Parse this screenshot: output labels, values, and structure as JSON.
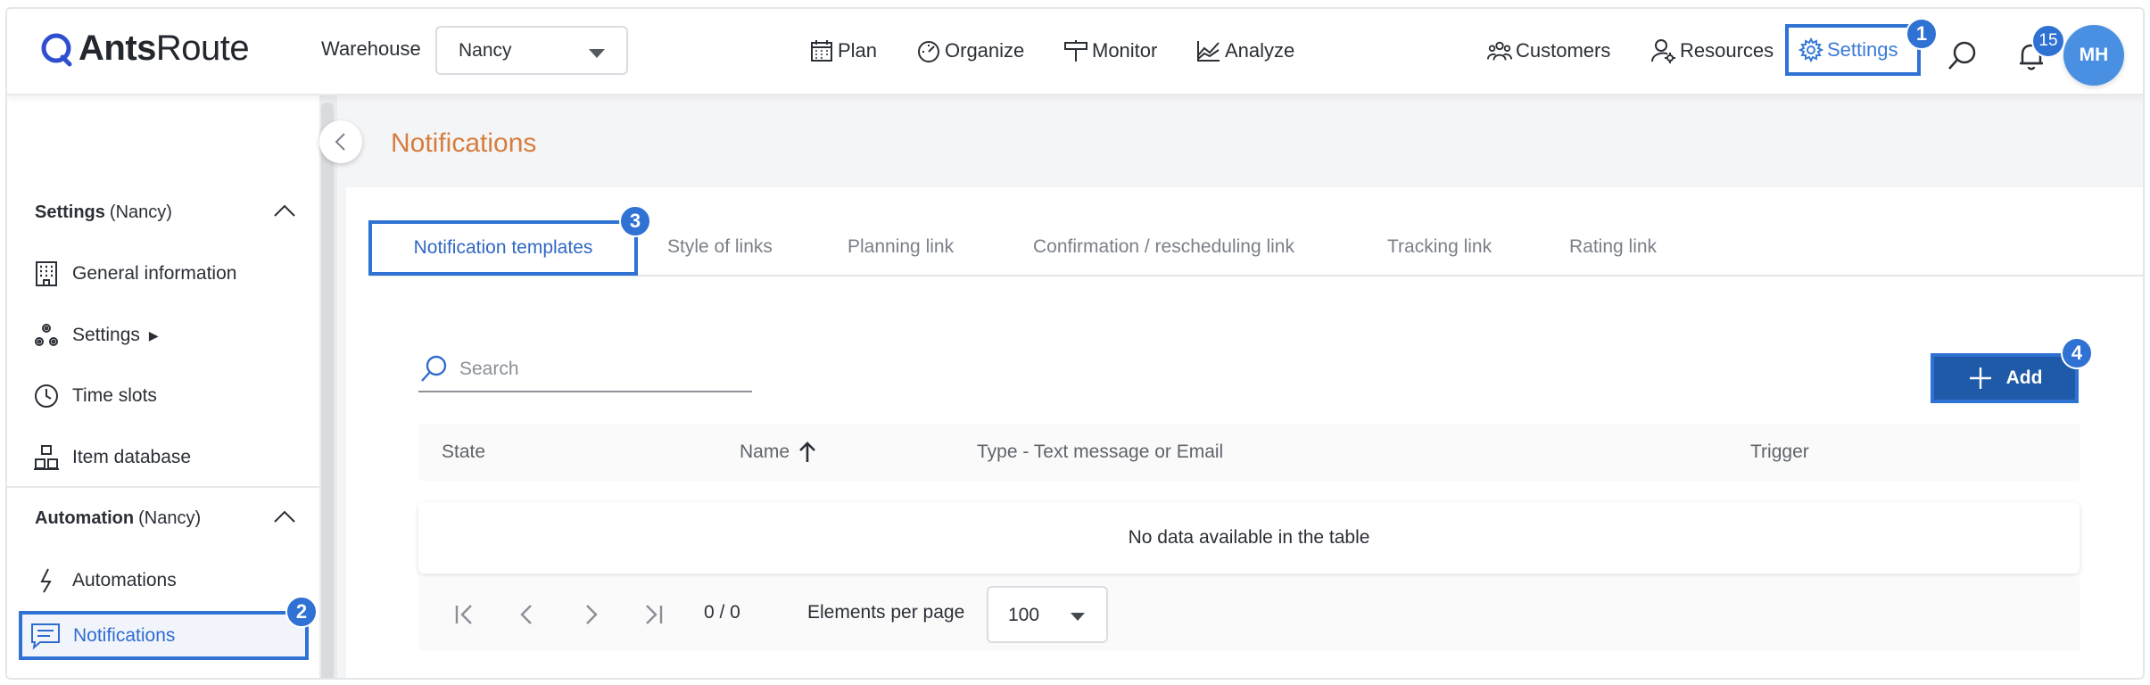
{
  "brand": {
    "name_bold": "Ants",
    "name_light": "Route",
    "accent": "#2f72d4"
  },
  "header": {
    "warehouse_label": "Warehouse",
    "warehouse_value": "Nancy",
    "nav": {
      "plan": "Plan",
      "organize": "Organize",
      "monitor": "Monitor",
      "analyze": "Analyze"
    },
    "customers": "Customers",
    "resources": "Resources",
    "settings": "Settings",
    "notification_count": "15",
    "avatar_initials": "MH"
  },
  "markers": {
    "m1": "1",
    "m2": "2",
    "m3": "3",
    "m4": "4"
  },
  "sidebar": {
    "settings_section": {
      "title": "Settings",
      "scope": "(Nancy)"
    },
    "items": [
      {
        "label": "General information"
      },
      {
        "label": "Settings",
        "submenu_arrow": "▶"
      },
      {
        "label": "Time slots"
      },
      {
        "label": "Item database"
      }
    ],
    "automation_section": {
      "title": "Automation",
      "scope": "(Nancy)"
    },
    "automation_items": [
      {
        "label": "Automations"
      },
      {
        "label": "Notifications"
      }
    ]
  },
  "main": {
    "title": "Notifications",
    "tabs": [
      {
        "label": "Notification templates"
      },
      {
        "label": "Style of links"
      },
      {
        "label": "Planning link"
      },
      {
        "label": "Confirmation / rescheduling link"
      },
      {
        "label": "Tracking link"
      },
      {
        "label": "Rating link"
      }
    ],
    "search_placeholder": "Search",
    "add_label": "Add",
    "columns": [
      "State",
      "Name",
      "Type - Text message or Email",
      "Trigger"
    ],
    "empty_message": "No data available in the table",
    "pager": {
      "count": "0 / 0",
      "per_page_label": "Elements per page",
      "per_page_value": "100"
    }
  }
}
